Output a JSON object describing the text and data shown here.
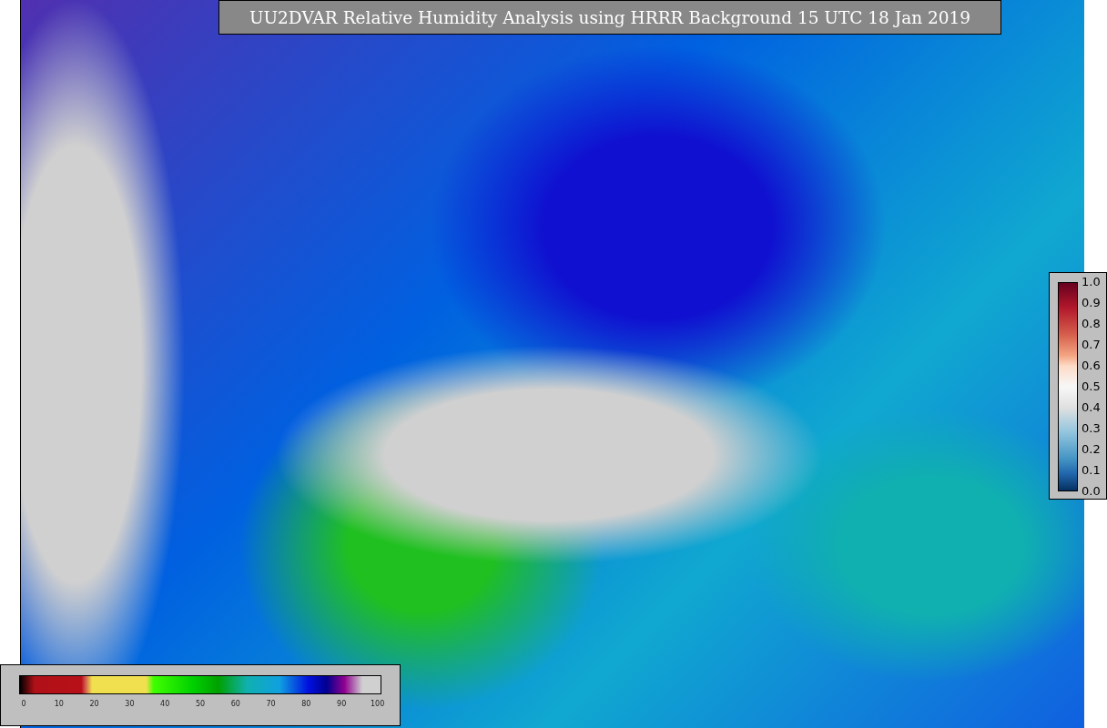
{
  "title": "UU2DVAR Relative Humidity Analysis using HRRR Background 15 UTC 18 Jan 2019",
  "observation_colorbar": {
    "ticks": [
      "1.0",
      "0.9",
      "0.8",
      "0.7",
      "0.6",
      "0.5",
      "0.4",
      "0.3",
      "0.2",
      "0.1",
      "0.0"
    ]
  },
  "humidity_colorbar": {
    "ticks": [
      "0",
      "10",
      "20",
      "30",
      "40",
      "50",
      "60",
      "70",
      "80",
      "90",
      "100"
    ]
  }
}
